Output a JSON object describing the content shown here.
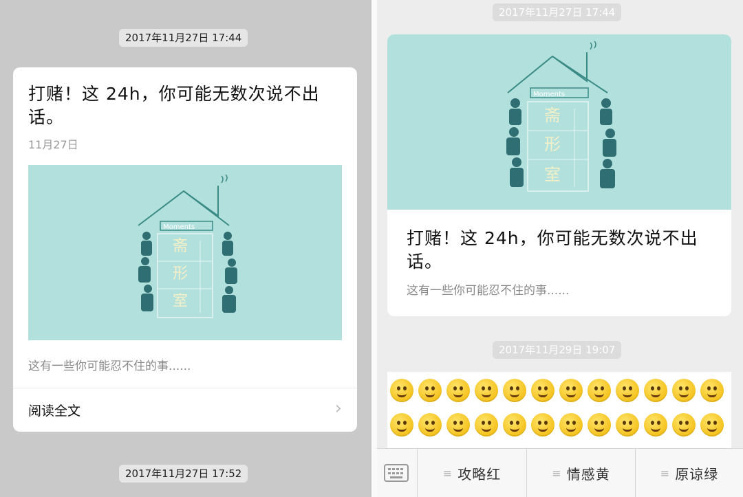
{
  "left": {
    "timestamp_top": "2017年11月27日 17:44",
    "article": {
      "title": "打赌！这 24h，你可能无数次说不出话。",
      "date": "11月27日",
      "cover_brand": "Moments",
      "cover_chars": [
        "斋",
        "形",
        "室"
      ],
      "description": "这有一些你可能忍不住的事......",
      "read_label": "阅读全文"
    },
    "timestamp_bottom": "2017年11月27日 17:52"
  },
  "right": {
    "timestamp_top": "2017年11月27日 17:44",
    "article": {
      "cover_brand": "Moments",
      "cover_chars": [
        "斋",
        "形",
        "室"
      ],
      "title": "打赌！这 24h，你可能无数次说不出话。",
      "description": "这有一些你可能忍不住的事......"
    },
    "timestamp_mid": "2017年11月29日 19:07",
    "menu": {
      "items": [
        {
          "label": "攻略红"
        },
        {
          "label": "情感黄"
        },
        {
          "label": "原谅绿"
        }
      ]
    }
  },
  "colors": {
    "cover_bg": "#b2e0dc",
    "chat_bg_left": "#c9c9c9",
    "chat_bg_right": "#ededed"
  }
}
